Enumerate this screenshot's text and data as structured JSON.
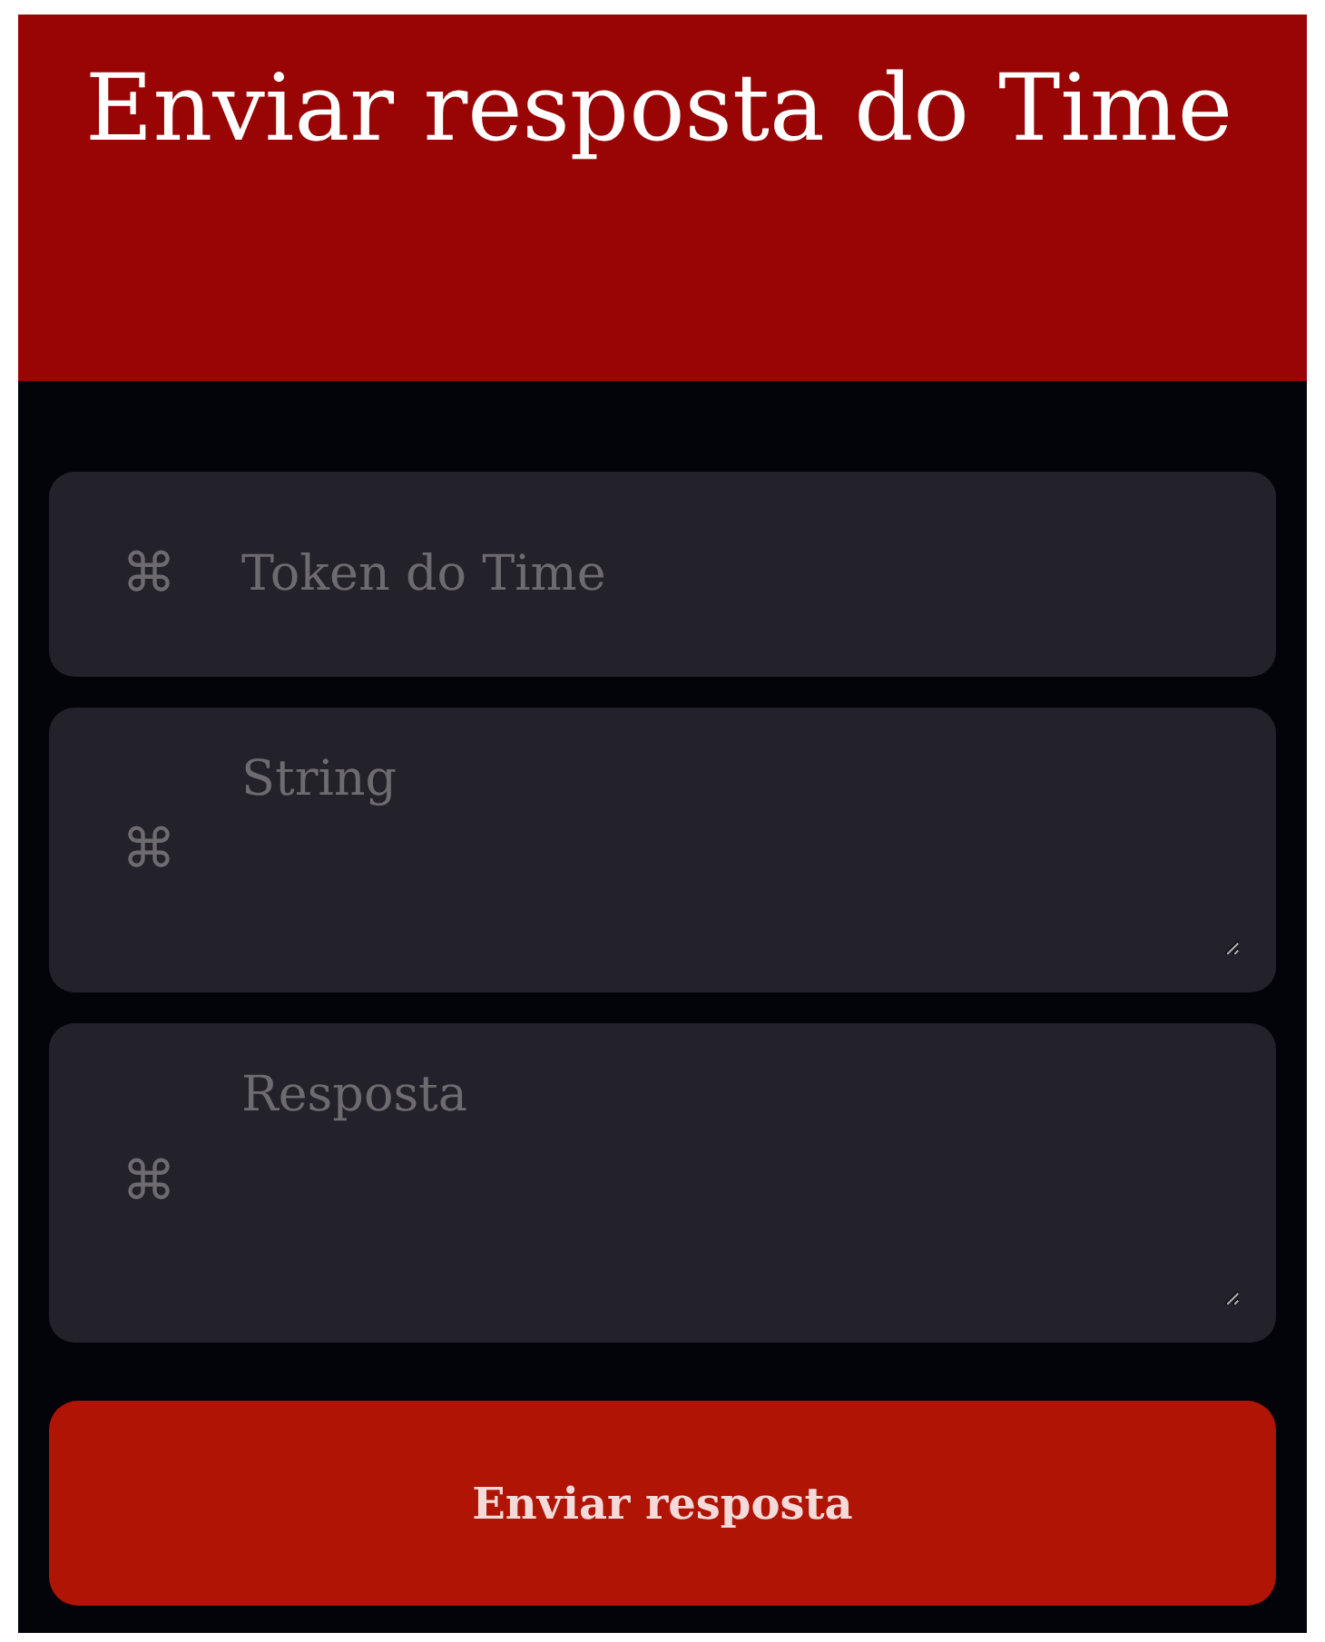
{
  "header": {
    "title": "Enviar resposta do Time"
  },
  "fields": [
    {
      "kind": "input",
      "icon": "⌘",
      "placeholder": "Token do Time"
    },
    {
      "kind": "textarea",
      "icon": "⌘",
      "placeholder": "String"
    },
    {
      "kind": "textarea",
      "icon": "⌘",
      "placeholder": "Resposta"
    }
  ],
  "submit_button": {
    "label": "Enviar resposta"
  }
}
